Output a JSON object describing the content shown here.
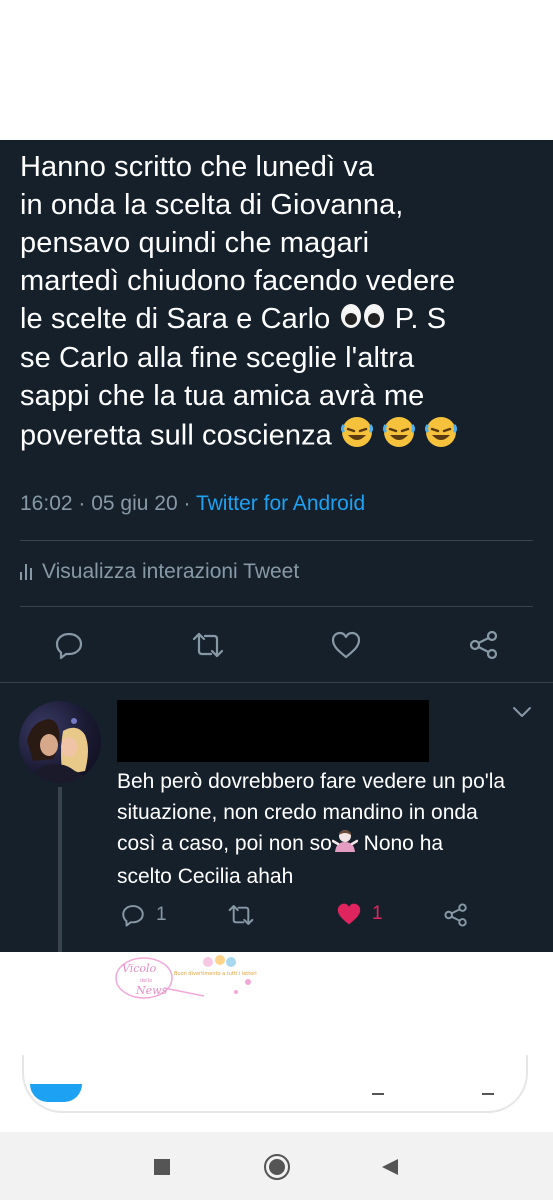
{
  "tweet": {
    "lines": [
      "Hanno scritto che lunedì va",
      "in onda la scelta di Giovanna,",
      "pensavo quindi che magari",
      "martedì chiudono facendo vedere",
      "le scelte di Sara e Carlo",
      "P. S",
      "se Carlo alla fine sceglie l'altra",
      "sappi che la tua amica avrà me",
      "poveretta sull coscienza"
    ],
    "emoji_eyes": "eyes-emoji",
    "emoji_laugh": "rolling-on-floor-laughing-emoji",
    "time": "16:02",
    "date": "05 giu 20",
    "source": "Twitter for Android",
    "interactions_label": "Visualizza interazioni Tweet"
  },
  "reply": {
    "lines": [
      "Beh però dovrebbero fare vedere un po'la",
      "situazione, non credo mandino in onda",
      "così a caso, poi non so",
      "Nono ha",
      "scelto Cecilia ahah"
    ],
    "emoji_shrug": "person-shrugging-emoji",
    "reply_count": "1",
    "like_count": "1",
    "like_color": "#e0245e"
  },
  "watermark": {
    "text1": "Vicolo",
    "text2": "delle",
    "text3": "News",
    "text4": "Buon divertimento a tutti i lettori"
  },
  "colors": {
    "background": "#15202b",
    "text": "#ffffff",
    "secondary": "#8899a6",
    "accent": "#1da1f2",
    "divider": "#38444d"
  }
}
